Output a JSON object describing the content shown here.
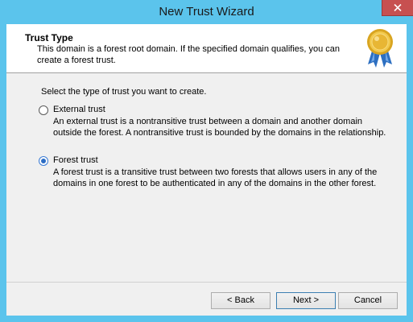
{
  "window": {
    "title": "New Trust Wizard"
  },
  "header": {
    "title": "Trust Type",
    "description": "This domain is a forest root domain. If the specified domain qualifies, you can create a forest trust."
  },
  "prompt": "Select the type of trust you want to create.",
  "options": [
    {
      "label": "External trust",
      "description": "An external trust is a nontransitive trust between a domain and another domain outside the forest. A nontransitive trust is bounded by the domains in the relationship.",
      "selected": false
    },
    {
      "label": "Forest trust",
      "description": "A forest trust is a transitive trust between two forests that allows users in any of the domains in one forest to be authenticated in any of the domains in the other forest.",
      "selected": true
    }
  ],
  "buttons": {
    "back": "< Back",
    "next": "Next >",
    "cancel": "Cancel"
  },
  "icons": {
    "close": "close-icon",
    "badge": "award-ribbon-icon"
  },
  "colors": {
    "frame": "#5bc4ec",
    "close": "#c75050",
    "radio_selected": "#2b6cc4"
  }
}
